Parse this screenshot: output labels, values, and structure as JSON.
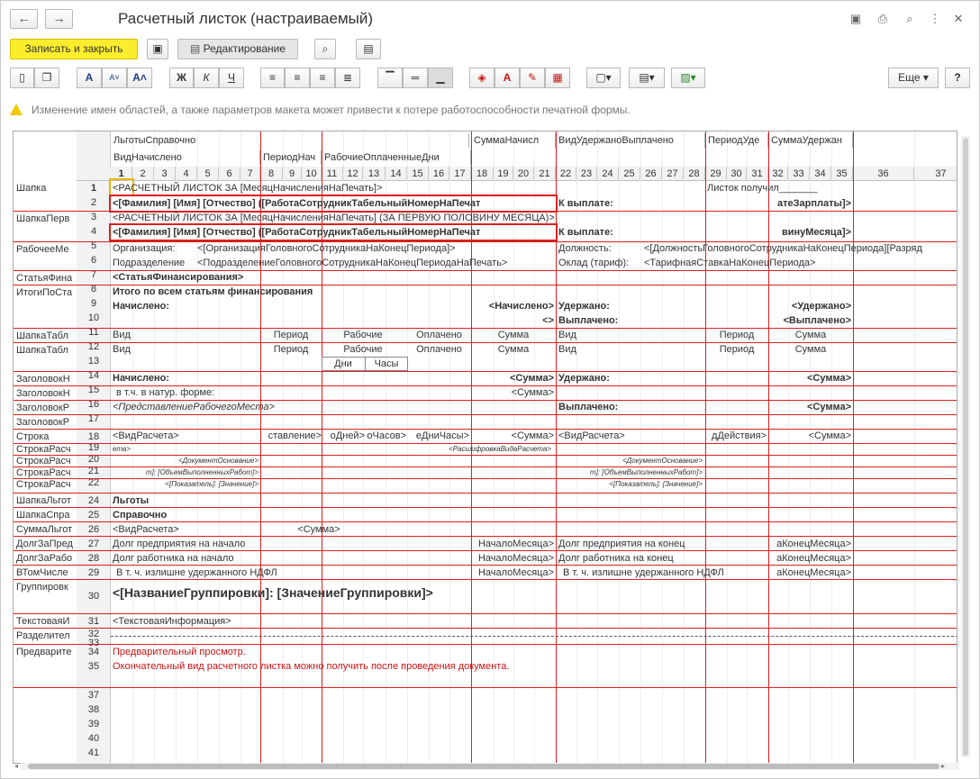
{
  "window": {
    "title": "Расчетный листок (настраиваемый)",
    "back": "←",
    "forward": "→"
  },
  "toolbar": {
    "save_close": "Записать и закрыть",
    "editing": "Редактирование",
    "more": "Еще",
    "help": "?",
    "bold": "Ж",
    "italic": "К",
    "underline": "Ч"
  },
  "warning": "Изменение имен областей, а также параметров макета может привести к потере работоспособности печатной формы.",
  "groups": {
    "lgoty": "ЛьготыСправочно",
    "vid_nach": "ВидНачислено",
    "period_nach": "ПериодНач",
    "rabochie": "РабочиеОплаченныеДни",
    "summa_nach": "СуммаНачисл",
    "vid_uderzh": "ВидУдержаноВыплачено",
    "period_ud": "ПериодУде",
    "summa_uderzh": "СуммаУдержан"
  },
  "columns": [
    "1",
    "2",
    "3",
    "4",
    "5",
    "6",
    "7",
    "8",
    "9",
    "10",
    "11",
    "12",
    "13",
    "14",
    "15",
    "16",
    "17",
    "18",
    "19",
    "20",
    "21",
    "22",
    "23",
    "24",
    "25",
    "26",
    "27",
    "28",
    "29",
    "30",
    "31",
    "32",
    "33",
    "34",
    "35",
    "36",
    "37"
  ],
  "rows": [
    "1",
    "2",
    "3",
    "4",
    "5",
    "6",
    "7",
    "8",
    "9",
    "10",
    "11",
    "12",
    "13",
    "14",
    "15",
    "16",
    "17",
    "18",
    "19",
    "20",
    "21",
    "22",
    "24",
    "25",
    "26",
    "27",
    "28",
    "29",
    "30",
    "31",
    "32",
    "33",
    "34",
    "35",
    "37",
    "38",
    "39",
    "40",
    "41"
  ],
  "area_labels": {
    "shapka": "Шапка",
    "shapka_perv": "ШапкаПерв",
    "rabochee_me": "РабочееМе",
    "statya_fin": "СтатьяФина",
    "itogi_po": "ИтогиПоСта",
    "shapka_tabl1": "ШапкаТабл",
    "shapka_tabl2": "ШапкаТабл",
    "zagolovok1": "ЗаголовокН",
    "zagolovok2": "ЗаголовокН",
    "zagolovok_r1": "ЗаголовокР",
    "zagolovok_r2": "ЗаголовокР",
    "stroka": "Строка",
    "stroka_ras1": "СтрокаРасч",
    "stroka_ras2": "СтрокаРасч",
    "stroka_ras3": "СтрокаРасч",
    "stroka_ras4": "СтрокаРасч",
    "shapka_lgot": "ШапкаЛьгот",
    "shapka_spr": "ШапкаСпра",
    "summa_lgot": "СуммаЛьгот",
    "dolg_pred": "ДолгЗаПред",
    "dolg_rab": "ДолгЗаРабо",
    "v_tom_chisle": "ВТомЧисле",
    "gruppirovk": "Группировк",
    "tekstovaya": "ТекстоваяИ",
    "razdelitel": "Разделител",
    "predvarite": "Предварите"
  },
  "cells": {
    "r1a": "<РАСЧЕТНЫЙ ЛИСТОК ЗА [МесяцНачисленияНаПечать]>",
    "r1b": "Листок получил_______",
    "r2a": "<[Фамилия] [Имя] [Отчество] ([РаботаСотрудникТабельныйНомерНаПечат",
    "r2b": "К выплате:",
    "r2c": "атеЗарплаты]>",
    "r3a": "<РАСЧЕТНЫЙ ЛИСТОК ЗА [МесяцНачисленияНаПечать] (ЗА ПЕРВУЮ ПОЛОВИНУ МЕСЯЦА)>",
    "r4a": "<[Фамилия] [Имя] [Отчество] ([РаботаСотрудникТабельныйНомерНаПечат",
    "r4b": "К выплате:",
    "r4c": "винуМесяца]>",
    "r5a": "Организация:",
    "r5b": "<[ОрганизацияГоловногоСотрудникаНаКонецПериода]>",
    "r5c": "Должность:",
    "r5d": "<[ДолжностьГоловногоСотрудникаНаКонецПериода][Разряд",
    "r6a": "Подразделение",
    "r6b": "<ПодразделениеГоловногоСотрудникаНаКонецПериодаНаПечать>",
    "r6c": "Оклад (тариф):",
    "r6d": "<ТарифнаяСтавкаНаКонецПериода>",
    "r7a": "<СтатьяФинансирования>",
    "r8a": "Итого по всем статьям финансирования",
    "r9a": "Начислено:",
    "r9b": "<Начислено>",
    "r9c": "Удержано:",
    "r9d": "<Удержано>",
    "r10a": "<>",
    "r10b": "Выплачено:",
    "r10c": "<Выплачено>",
    "r11a": "Вид",
    "r11b": "Период",
    "r11c": "Рабочие",
    "r11d": "Оплачено",
    "r11e": "Сумма",
    "r11f": "Вид",
    "r11g": "Период",
    "r11h": "Сумма",
    "r12a": "Вид",
    "r12b": "Период",
    "r12c": "Рабочие",
    "r12d": "Оплачено",
    "r12e": "Сумма",
    "r12f": "Вид",
    "r12g": "Период",
    "r12h": "Сумма",
    "r13a": "Дни",
    "r13b": "Часы",
    "r14a": "Начислено:",
    "r14b": "<Сумма>",
    "r14c": "Удержано:",
    "r14d": "<Сумма>",
    "r15a": "в т.ч. в натур. форме:",
    "r15b": "<Сумма>",
    "r16a": "<ПредставлениеРабочегоМеста>",
    "r16b": "Выплачено:",
    "r16c": "<Сумма>",
    "r18a": "<ВидРасчета>",
    "r18b": "ставление>",
    "r18c": "оДней>",
    "r18d": "оЧасов>",
    "r18e": "еДниЧасы>",
    "r18f": "<Сумма>",
    "r18g": "<ВидРасчета>",
    "r18h": "дДействия>",
    "r18i": "<Сумма>",
    "r19a": "ета>",
    "r19b": "<РасшифровкаВидаРасчета>",
    "r20a": "<ДокументОснование>",
    "r20b": "<ДокументОснование>",
    "r21a": "т]: [ОбъемВыполненныхРабот]>",
    "r21b": "т]: [ОбъемВыполненныхРабот]>",
    "r22a": "<[Показатель]: [Значение]>",
    "r22b": "<[Показатель]: [Значение]>",
    "r24a": "Льготы",
    "r25a": "Справочно",
    "r26a": "<ВидРасчета>",
    "r26b": "<Сумма>",
    "r27a": "Долг предприятия на начало",
    "r27b": "НачалоМесяца>",
    "r27c": "Долг предприятия на конец",
    "r27d": "аКонецМесяца>",
    "r28a": "Долг работника на начало",
    "r28b": "НачалоМесяца>",
    "r28c": "Долг работника на конец",
    "r28d": "аКонецМесяца>",
    "r29a": "В т. ч. излишне удержанного НДФЛ",
    "r29b": "НачалоМесяца>",
    "r29c": "В т. ч. излишне удержанного НДФЛ",
    "r29d": "аКонецМесяца>",
    "r30a": "<[НазваниеГруппировки]: [ЗначениеГруппировки]>",
    "r31a": "<ТекстоваяИнформация>",
    "r34a": "Предварительный просмотр.",
    "r35a": "Окончательный вид расчетного листка можно получить после проведения документа."
  },
  "colors": {
    "accent_yellow": "#fbed2c",
    "area_line": "#d9201f",
    "warning": "#f3c800"
  }
}
